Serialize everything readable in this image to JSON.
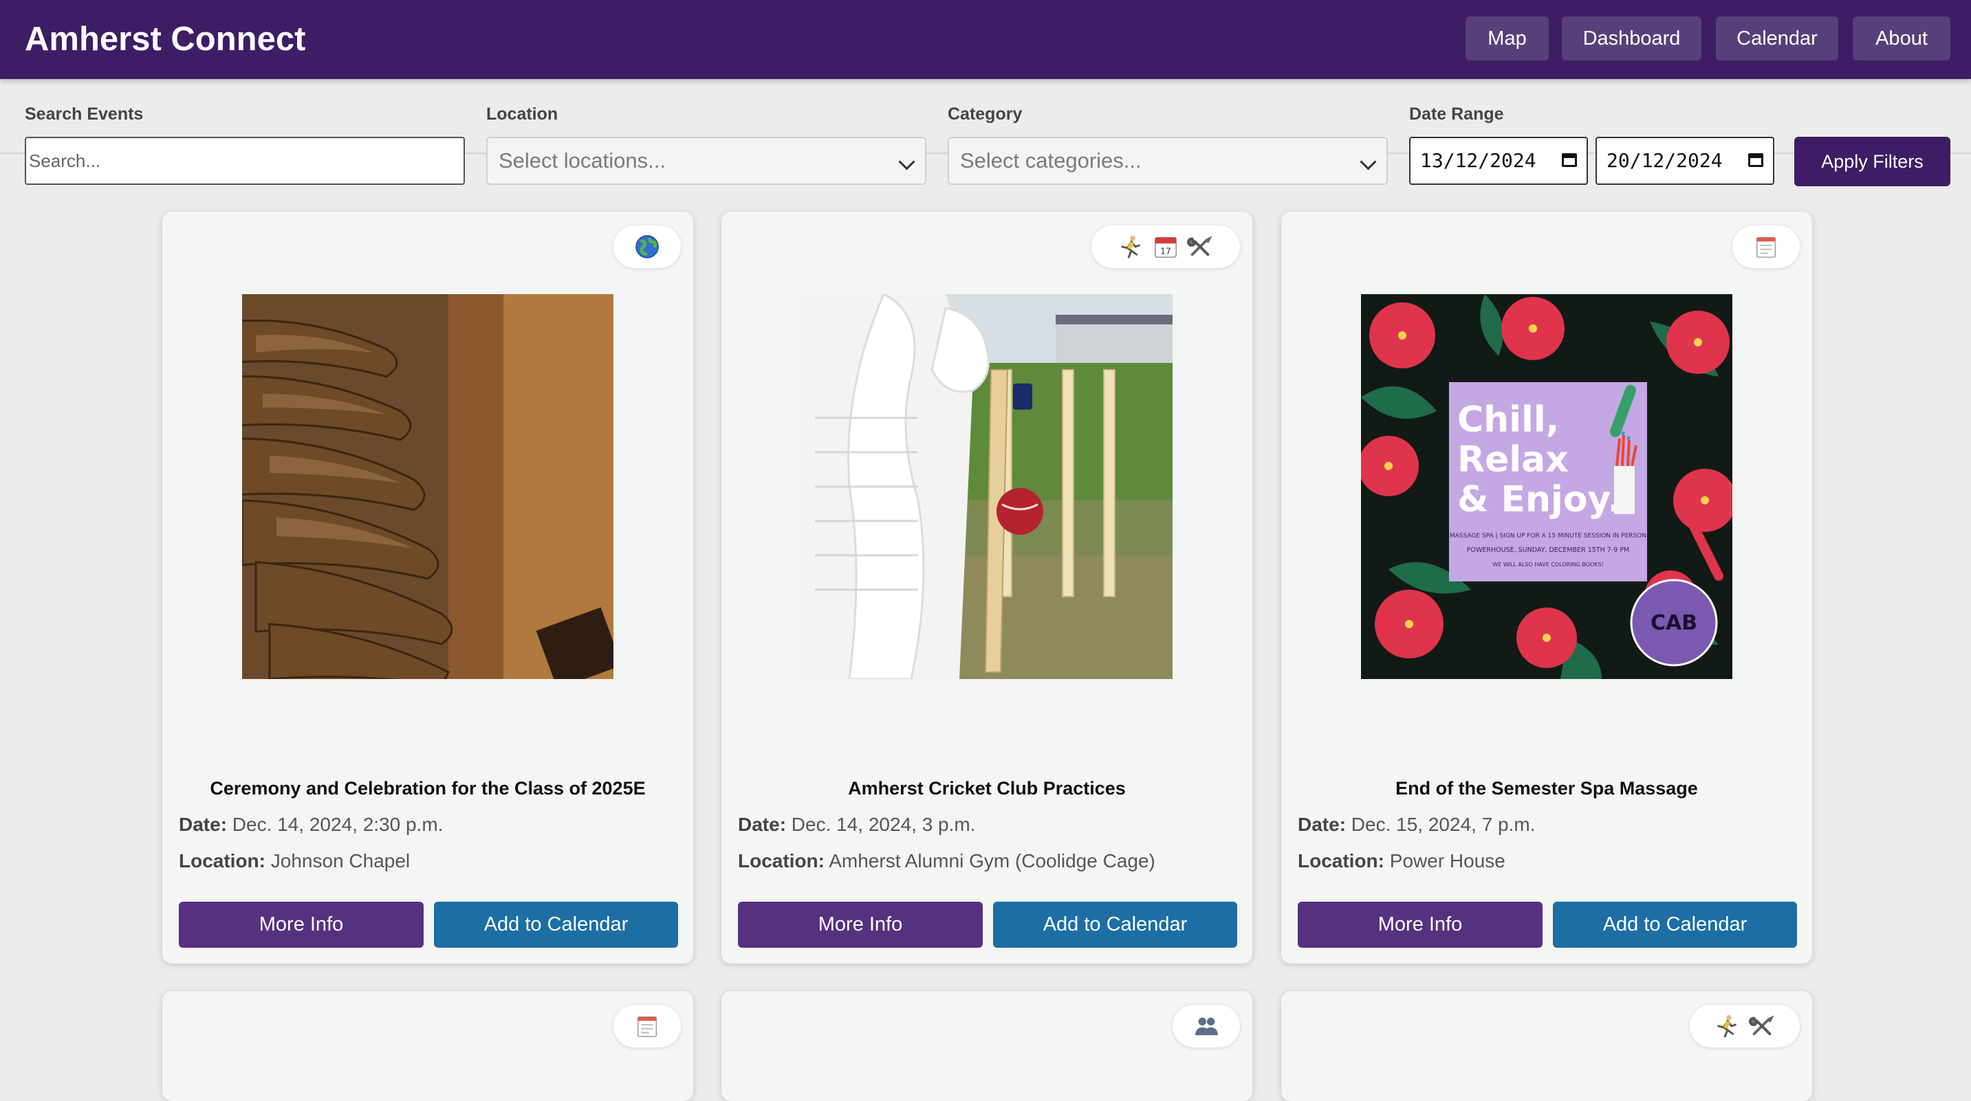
{
  "header": {
    "title": "Amherst Connect",
    "nav": [
      "Map",
      "Dashboard",
      "Calendar",
      "About"
    ]
  },
  "filters": {
    "search_label": "Search Events",
    "search_placeholder": "Search...",
    "location_label": "Location",
    "location_placeholder": "Select locations...",
    "category_label": "Category",
    "category_placeholder": "Select categories...",
    "date_label": "Date Range",
    "date_start": "13/12/2024",
    "date_end": "20/12/2024",
    "apply_label": "Apply Filters"
  },
  "colors": {
    "header": "#3d1d63",
    "more_info": "#56317f",
    "add_to_calendar": "#1c6ea4"
  },
  "labels": {
    "date": "Date:",
    "location": "Location:",
    "more_info": "More Info",
    "add_to_calendar": "Add to Calendar"
  },
  "events": [
    {
      "title": "Ceremony and Celebration for the Class of 2025E",
      "date": "Dec. 14, 2024, 2:30 p.m.",
      "location": "Johnson Chapel",
      "icons": [
        "globe-icon"
      ],
      "image": "wooden-chair-backs-photo"
    },
    {
      "title": "Amherst Cricket Club Practices",
      "date": "Dec. 14, 2024, 3 p.m.",
      "location": "Amherst Alumni Gym (Coolidge Cage)",
      "icons": [
        "runner-icon",
        "calendar-icon",
        "tools-icon"
      ],
      "image": "cricket-batter-photo"
    },
    {
      "title": "End of the Semester Spa Massage",
      "date": "Dec. 15, 2024, 7 p.m.",
      "location": "Power House",
      "icons": [
        "notepad-icon"
      ],
      "image": "spa-flyer",
      "flyer": {
        "headline": [
          "Chill,",
          "Relax",
          "& Enjoy."
        ],
        "line1": "MASSAGE SPA | SIGN UP FOR A 15 MINUTE SESSION IN PERSON",
        "line2": "POWERHOUSE, SUNDAY, DECEMBER 15TH 7-9 PM",
        "line3": "WE WILL ALSO HAVE COLORING BOOKS!",
        "logo": "CAB"
      }
    }
  ],
  "more_events": [
    {
      "icons": [
        "notepad-icon"
      ]
    },
    {
      "icons": [
        "people-icon"
      ]
    },
    {
      "icons": [
        "runner-icon",
        "tools-icon"
      ]
    }
  ]
}
